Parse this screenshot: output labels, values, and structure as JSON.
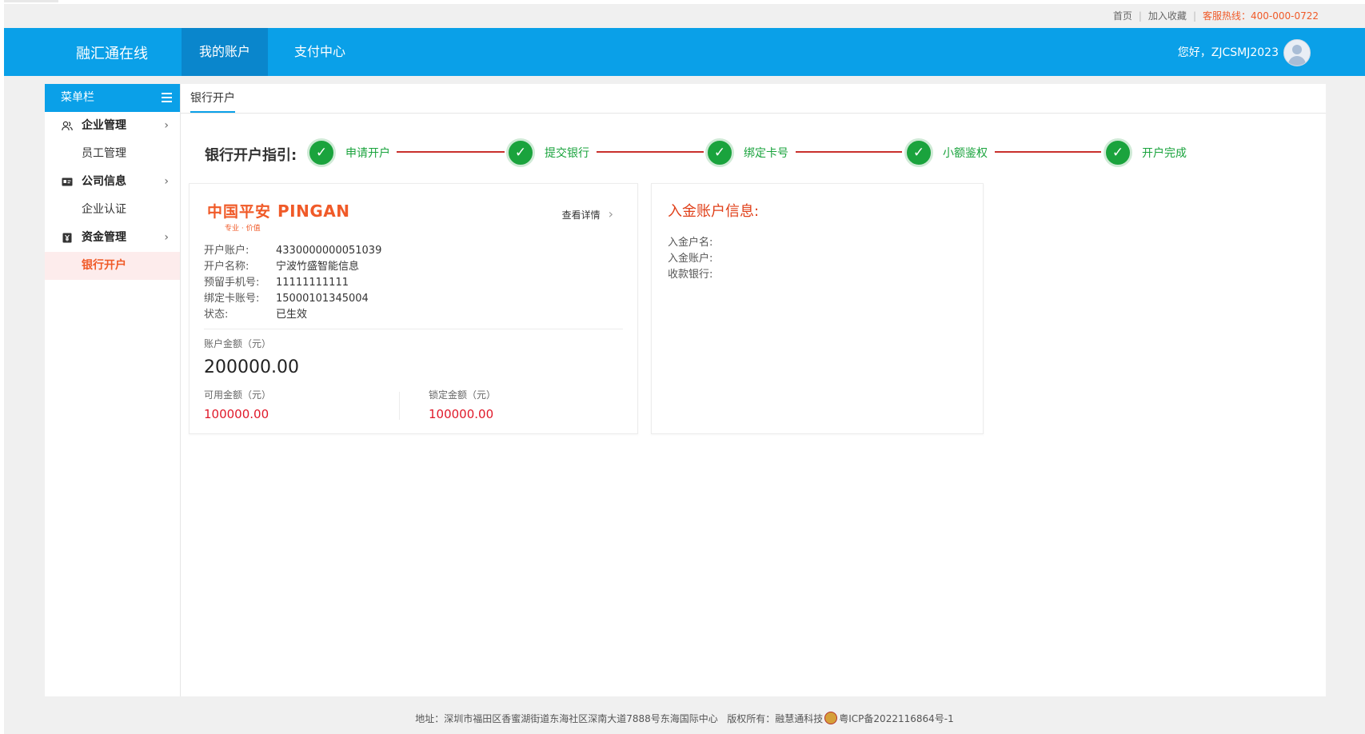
{
  "topbar": {
    "home": "首页",
    "favorite": "加入收藏",
    "hotline": "客服热线：400-000-0722"
  },
  "header": {
    "brand": "融汇通在线",
    "tabs": [
      {
        "label": "我的账户",
        "active": true
      },
      {
        "label": "支付中心",
        "active": false
      }
    ],
    "greeting": "您好，ZJCSMJ2023"
  },
  "sidebar": {
    "title": "菜单栏",
    "groups": [
      {
        "label": "企业管理",
        "icon": "users-icon",
        "items": [
          "员工管理"
        ]
      },
      {
        "label": "公司信息",
        "icon": "id-card-icon",
        "items": [
          "企业认证"
        ]
      },
      {
        "label": "资金管理",
        "icon": "yen-icon",
        "items": [
          "银行开户"
        ]
      }
    ],
    "active_item": "银行开户"
  },
  "main": {
    "tab": "银行开户",
    "guide_label": "银行开户指引:",
    "steps": [
      "申请开户",
      "提交银行",
      "绑定卡号",
      "小额鉴权",
      "开户完成"
    ],
    "account_card": {
      "bank_name_cn": "中国平安",
      "bank_name_en": "PINGAN",
      "bank_tagline": "专业 · 价值",
      "detail_link": "查看详情",
      "fields": [
        {
          "key": "开户账户:",
          "value": "4330000000051039"
        },
        {
          "key": "开户名称:",
          "value": "宁波竹盛智能信息"
        },
        {
          "key": "预留手机号:",
          "value": "11111111111"
        },
        {
          "key": "绑定卡账号:",
          "value": "15000101345004"
        },
        {
          "key": "状态:",
          "value": "已生效"
        }
      ],
      "balance_label": "账户金额（元）",
      "balance": "200000.00",
      "available_label": "可用金额（元）",
      "available": "100000.00",
      "locked_label": "锁定金额（元）",
      "locked": "100000.00"
    },
    "income_card": {
      "title": "入金账户信息:",
      "rows": [
        "入金户名:",
        "入金账户:",
        "收款银行:"
      ]
    }
  },
  "footer": {
    "address": "地址：深圳市福田区香蜜湖街道东海社区深南大道7888号东海国际中心",
    "copyright": "版权所有：融慧通科技",
    "icp": "粤ICP备2022116864号-1"
  },
  "colors": {
    "header_blue": "#0aa0e8",
    "active_tab_blue": "#0a86cc",
    "accent_orange": "#f05a28",
    "step_green": "#1aa33d",
    "step_line_red": "#c9302c",
    "amount_red": "#e0192a"
  }
}
